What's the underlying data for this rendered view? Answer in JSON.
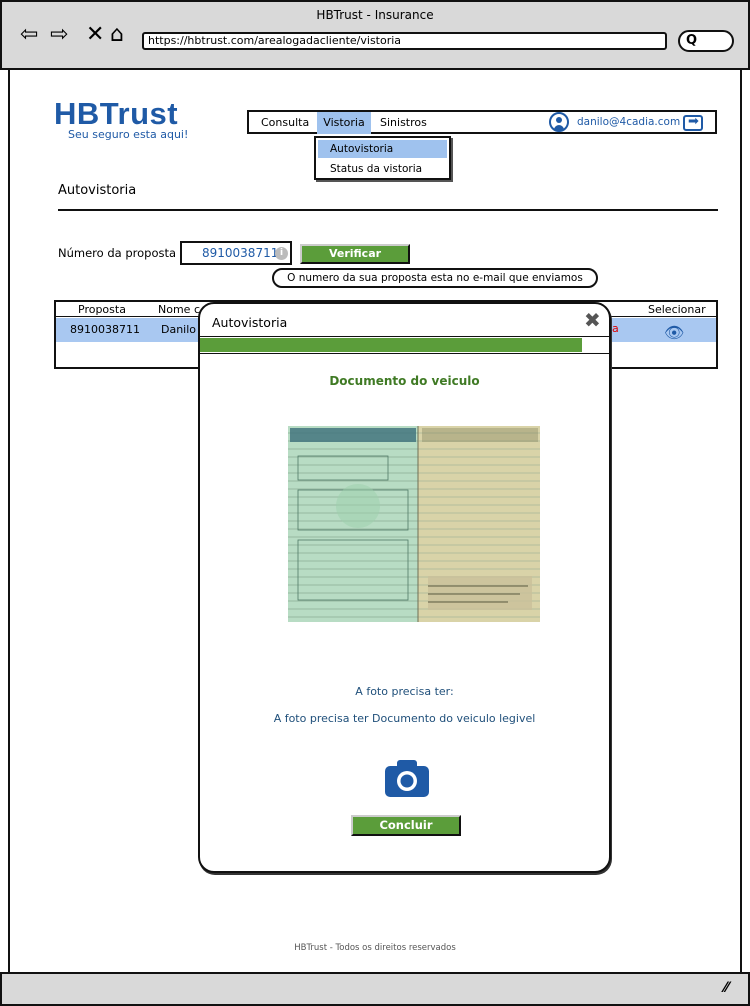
{
  "browser": {
    "title": "HBTrust - Insurance",
    "url": "https://hbtrust.com/arealogadacliente/vistoria"
  },
  "header": {
    "logo": "HBTrust",
    "slogan": "Seu seguro esta aqui!",
    "nav": [
      "Consulta",
      "Vistoria",
      "Sinistros"
    ],
    "user_email": "danilo@4cadia.com"
  },
  "dropdown": [
    "Autovistoria",
    "Status da vistoria"
  ],
  "page": {
    "title": "Autovistoria",
    "proposal_label": "Número da proposta",
    "proposal_value": "8910038711",
    "verify_label": "Verificar",
    "tooltip": "O numero da sua proposta esta no e-mail que enviamos"
  },
  "table": {
    "headers": [
      "Proposta",
      "Nome c",
      "Selecionar"
    ],
    "row": [
      "8910038711",
      "Danilo"
    ],
    "row_tail": "a"
  },
  "modal": {
    "title": "Autovistoria",
    "progress_fraction": 0.935,
    "heading": "Documento do veiculo",
    "photo_requirement_title": "A foto precisa ter:",
    "photo_requirement": "A foto precisa ter Documento do veiculo legivel",
    "conclude_label": "Concluir"
  },
  "footer": "HBTrust - Todos os direitos reservados",
  "colors": {
    "brand": "#1f5aa6",
    "green": "#5b9d3a",
    "highlight": "#9fc2ee"
  }
}
